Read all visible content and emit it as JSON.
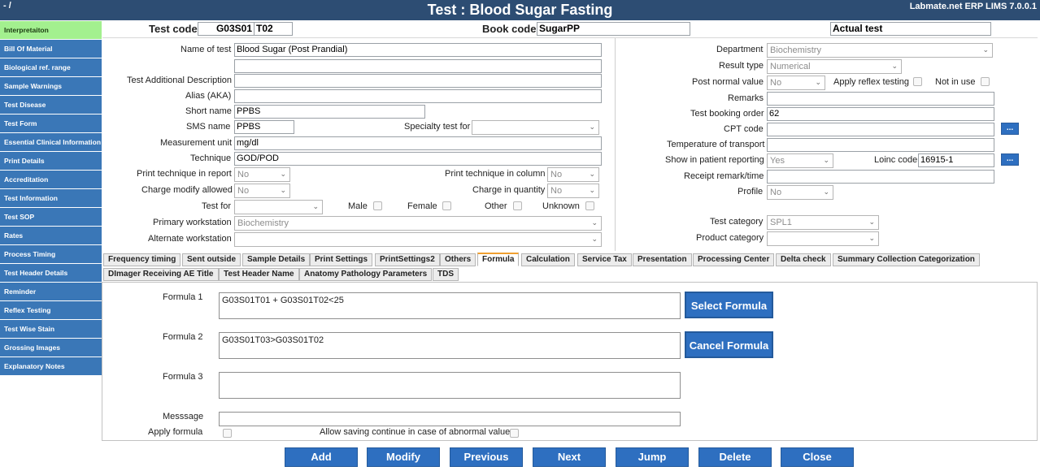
{
  "window": {
    "back_label": "- /",
    "title": "Test : Blood Sugar Fasting",
    "product": "Labmate.net ERP LIMS 7.0.0.1"
  },
  "sidebar": {
    "items": [
      {
        "label": "Interpretaiton"
      },
      {
        "label": "Bill Of Material"
      },
      {
        "label": "Biological ref. range"
      },
      {
        "label": "Sample Warnings"
      },
      {
        "label": "Test Disease"
      },
      {
        "label": "Test Form"
      },
      {
        "label": "Essential Clinical Information"
      },
      {
        "label": "Print Details"
      },
      {
        "label": "Accreditation"
      },
      {
        "label": "Test Information"
      },
      {
        "label": "Test SOP"
      },
      {
        "label": "Rates"
      },
      {
        "label": "Process Timing"
      },
      {
        "label": "Test Header Details"
      },
      {
        "label": "Reminder"
      },
      {
        "label": "Reflex Testing"
      },
      {
        "label": "Test Wise Stain"
      },
      {
        "label": "Grossing Images"
      },
      {
        "label": "Explanatory Notes"
      }
    ]
  },
  "header": {
    "test_code_label": "Test code",
    "test_code_part1": "G03S01",
    "test_code_part2": "T02",
    "book_code_label": "Book code",
    "book_code_value": "SugarPP",
    "actual_test_value": "Actual test"
  },
  "left_form": {
    "name_label": "Name of test",
    "name_value": "Blood Sugar (Post Prandial)",
    "name_value2": "",
    "additional_desc_label": "Test Additional Description",
    "additional_desc_value": "",
    "alias_label": "Alias (AKA)",
    "alias_value": "",
    "short_name_label": "Short name",
    "short_name_value": "PPBS",
    "sms_name_label": "SMS name",
    "sms_name_value": "PPBS",
    "specialty_label": "Specialty test for",
    "specialty_value": "",
    "unit_label": "Measurement unit",
    "unit_value": "mg/dl",
    "technique_label": "Technique",
    "technique_value": "GOD/POD",
    "print_tech_report_label": "Print technique in report",
    "print_tech_report_value": "No",
    "print_tech_column_label": "Print technique in column",
    "print_tech_column_value": "No",
    "charge_modify_label": "Charge modify allowed",
    "charge_modify_value": "No",
    "charge_quantity_label": "Charge in quantity",
    "charge_quantity_value": "No",
    "test_for_label": "Test for",
    "test_for_value": "",
    "male_label": "Male",
    "female_label": "Female",
    "other_label": "Other",
    "unknown_label": "Unknown",
    "primary_ws_label": "Primary workstation",
    "primary_ws_value": "Biochemistry",
    "alternate_ws_label": "Alternate workstation",
    "alternate_ws_value": ""
  },
  "right_form": {
    "department_label": "Department",
    "department_value": "Biochemistry",
    "result_type_label": "Result type",
    "result_type_value": "Numerical",
    "post_normal_label": "Post normal value",
    "post_normal_value": "No",
    "apply_reflex_label": "Apply reflex testing",
    "not_in_use_label": "Not in use",
    "remarks_label": "Remarks",
    "remarks_value": "",
    "booking_order_label": "Test booking order",
    "booking_order_value": "62",
    "cpt_label": "CPT code",
    "cpt_value": "",
    "cpt_btn": "...",
    "temperature_label": "Temperature of transport",
    "temperature_value": "",
    "show_patient_label": "Show in patient reporting",
    "show_patient_value": "Yes",
    "loinc_label": "Loinc code",
    "loinc_value": "16915-1",
    "loinc_btn": "...",
    "receipt_label": "Receipt remark/time",
    "receipt_value": "",
    "profile_label": "Profile",
    "profile_value": "No",
    "test_category_label": "Test category",
    "test_category_value": "SPL1",
    "product_category_label": "Product category",
    "product_category_value": ""
  },
  "tabs": {
    "row1": [
      "Frequency timing",
      "Sent outside",
      "Sample Details",
      "Print Settings",
      "PrintSettings2",
      "Others",
      "Formula",
      "Calculation",
      "Service Tax",
      "Presentation",
      "Processing Center",
      "Delta check",
      "Summary Collection Categorization"
    ],
    "row2": [
      "DImager Receiving AE Title",
      "Test Header Name",
      "Anatomy Pathology Parameters",
      "TDS"
    ]
  },
  "formula": {
    "f1_label": "Formula 1",
    "f1_value": "G03S01T01 + G03S01T02<25",
    "f2_label": "Formula 2",
    "f2_value": "G03S01T03>G03S01T02",
    "f3_label": "Formula 3",
    "f3_value": "",
    "message_label": "Messsage",
    "message_value": "",
    "apply_label": "Apply formula",
    "allow_saving_label": "Allow saving continue in case of abnormal value",
    "select_btn": "Select Formula",
    "cancel_btn": "Cancel Formula"
  },
  "bottom_buttons": {
    "add": "Add",
    "modify": "Modify",
    "previous": "Previous",
    "next": "Next",
    "jump": "Jump",
    "delete": "Delete",
    "close": "Close"
  },
  "colors": {
    "titlebar": "#2d4d73",
    "sidebar": "#3a77b7",
    "sidebar_active": "#a3f08f",
    "button": "#2e6fc0",
    "active_tab_accent": "#f0a030"
  }
}
